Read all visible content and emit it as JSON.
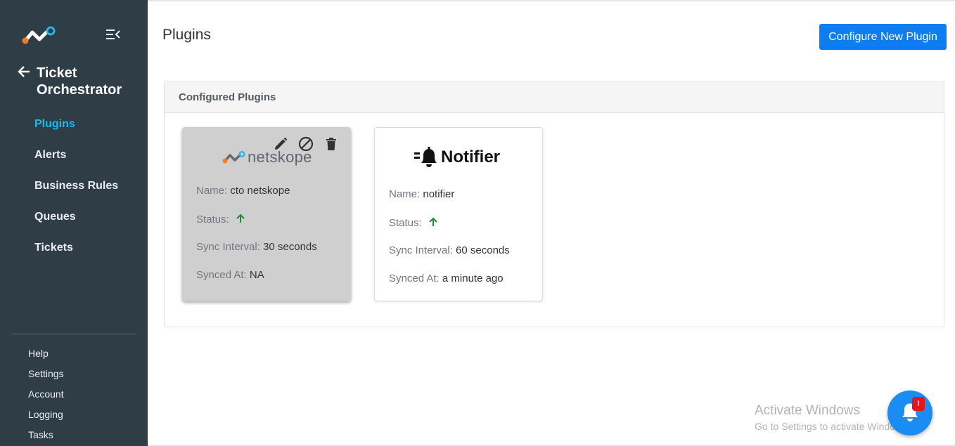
{
  "sidebar": {
    "module_title": "Ticket Orchestrator",
    "nav": [
      {
        "label": "Plugins",
        "active": true
      },
      {
        "label": "Alerts"
      },
      {
        "label": "Business Rules"
      },
      {
        "label": "Queues"
      },
      {
        "label": "Tickets"
      }
    ],
    "footer": [
      {
        "label": "Help"
      },
      {
        "label": "Settings"
      },
      {
        "label": "Account"
      },
      {
        "label": "Logging"
      },
      {
        "label": "Tasks"
      }
    ]
  },
  "header": {
    "title": "Plugins",
    "configure_button": "Configure New Plugin"
  },
  "panel": {
    "title": "Configured Plugins",
    "plugins": [
      {
        "logo_text": "netskope",
        "name_label": "Name:",
        "name": "cto netskope",
        "status_label": "Status:",
        "status_icon": "arrow-up-icon",
        "sync_interval_label": "Sync Interval:",
        "sync_interval": "30 seconds",
        "synced_at_label": "Synced At:",
        "synced_at": "NA",
        "state": "disabled"
      },
      {
        "logo_text": "Notifier",
        "name_label": "Name:",
        "name": "notifier",
        "status_label": "Status:",
        "status_icon": "arrow-up-icon",
        "sync_interval_label": "Sync Interval:",
        "sync_interval": "60 seconds",
        "synced_at_label": "Synced At:",
        "synced_at": "a minute ago",
        "state": "enabled"
      }
    ]
  },
  "watermark": {
    "line1": "Activate Windows",
    "line2": "Go to Settings to activate Windows."
  },
  "notification": {
    "badge": "!"
  },
  "colors": {
    "sidebar_bg": "#2f3d47",
    "active_nav": "#21b7e8",
    "primary": "#0d7ef2",
    "status_up": "#1e8a3c",
    "badge": "#e8141b"
  }
}
